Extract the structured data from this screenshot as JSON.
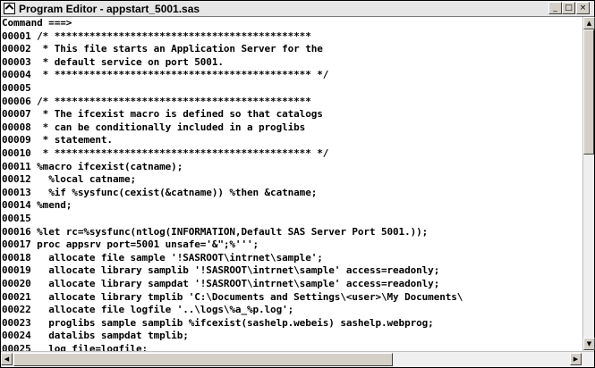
{
  "window": {
    "title": "Program Editor - appstart_5001.sas",
    "minimize_glyph": "_",
    "maximize_glyph": "□",
    "close_glyph": "×",
    "app_icon": "sas-program-editor-icon"
  },
  "editor": {
    "command_line": "Command ===>",
    "lines": [
      {
        "num": "00001",
        "text": "/* ********************************************"
      },
      {
        "num": "00002",
        "text": " * This file starts an Application Server for the"
      },
      {
        "num": "00003",
        "text": " * default service on port 5001."
      },
      {
        "num": "00004",
        "text": " * ******************************************** */"
      },
      {
        "num": "00005",
        "text": ""
      },
      {
        "num": "00006",
        "text": "/* ********************************************"
      },
      {
        "num": "00007",
        "text": " * The ifcexist macro is defined so that catalogs"
      },
      {
        "num": "00008",
        "text": " * can be conditionally included in a proglibs"
      },
      {
        "num": "00009",
        "text": " * statement."
      },
      {
        "num": "00010",
        "text": " * ******************************************** */"
      },
      {
        "num": "00011",
        "text": "%macro ifcexist(catname);"
      },
      {
        "num": "00012",
        "text": "  %local catname;"
      },
      {
        "num": "00013",
        "text": "  %if %sysfunc(cexist(&catname)) %then &catname;"
      },
      {
        "num": "00014",
        "text": "%mend;"
      },
      {
        "num": "00015",
        "text": ""
      },
      {
        "num": "00016",
        "text": "%let rc=%sysfunc(ntlog(INFORMATION,Default SAS Server Port 5001.));"
      },
      {
        "num": "00017",
        "text": "proc appsrv port=5001 unsafe='&\";%''';"
      },
      {
        "num": "00018",
        "text": "  allocate file sample '!SASROOT\\intrnet\\sample';"
      },
      {
        "num": "00019",
        "text": "  allocate library samplib '!SASROOT\\intrnet\\sample' access=readonly;"
      },
      {
        "num": "00020",
        "text": "  allocate library sampdat '!SASROOT\\intrnet\\sample' access=readonly;"
      },
      {
        "num": "00021",
        "text": "  allocate library tmplib 'C:\\Documents and Settings\\<user>\\My Documents\\"
      },
      {
        "num": "00022",
        "text": "  allocate file logfile '..\\logs\\%a_%p.log';"
      },
      {
        "num": "00023",
        "text": "  proglibs sample samplib %ifcexist(sashelp.webeis) sashelp.webprog;"
      },
      {
        "num": "00024",
        "text": "  datalibs sampdat tmplib;"
      },
      {
        "num": "00025",
        "text": "  log file=logfile;"
      }
    ]
  },
  "scrollbars": {
    "up_glyph": "▲",
    "down_glyph": "▼",
    "left_glyph": "◀",
    "right_glyph": "▶"
  }
}
